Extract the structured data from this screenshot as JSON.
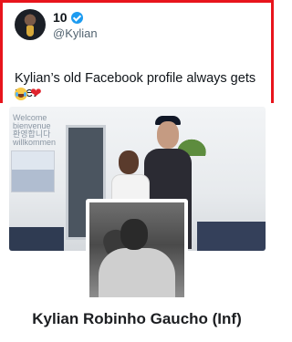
{
  "tweet": {
    "display_name": "10",
    "handle": "@Kylian",
    "text": "Kylian’s old Facebook profile always gets me.",
    "emojis": [
      "laughing-emoji",
      "red-heart-emoji"
    ]
  },
  "profile": {
    "cover_wall_text": "Welcome\nbienvenue\n환영합니다\nwillkommen",
    "name": "Kylian Robinho Gaucho (Inf)"
  },
  "colors": {
    "highlight_border": "#e8141c",
    "verified_badge": "#1d9bf0"
  }
}
